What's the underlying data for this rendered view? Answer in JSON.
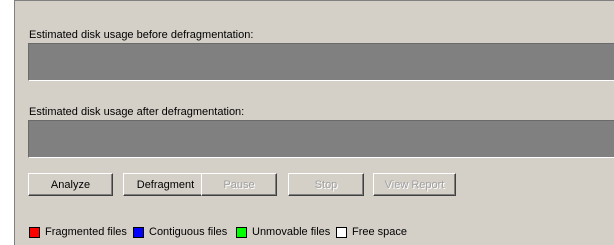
{
  "labels": {
    "before": "Estimated disk usage before defragmentation:",
    "after": "Estimated disk usage after defragmentation:"
  },
  "buttons": {
    "analyze": {
      "label": "Analyze",
      "enabled": true
    },
    "defragment": {
      "label": "Defragment",
      "enabled": true
    },
    "pause": {
      "label": "Pause",
      "enabled": false
    },
    "stop": {
      "label": "Stop",
      "enabled": false
    },
    "view_report": {
      "label": "View Report",
      "enabled": false
    }
  },
  "legend": [
    {
      "label": "Fragmented files",
      "color": "#ff0000",
      "icon": "red-square"
    },
    {
      "label": "Contiguous files",
      "color": "#0000ff",
      "icon": "blue-square"
    },
    {
      "label": "Unmovable files",
      "color": "#00ff00",
      "icon": "green-square"
    },
    {
      "label": "Free space",
      "color": "#ffffff",
      "icon": "white-square"
    }
  ],
  "colors": {
    "panel_background": "#d4d0c8",
    "usage_bar": "#808080"
  }
}
